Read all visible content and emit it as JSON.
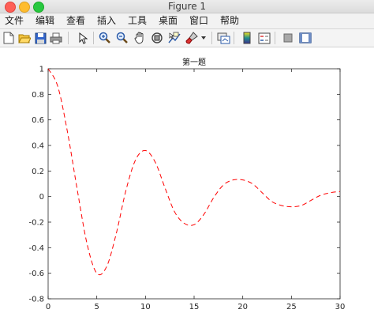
{
  "window": {
    "title": "Figure 1"
  },
  "menu": [
    "文件",
    "编辑",
    "查看",
    "插入",
    "工具",
    "桌面",
    "窗口",
    "帮助"
  ],
  "toolbar": {
    "icons": [
      "new-figure-icon",
      "open-file-icon",
      "save-icon",
      "print-icon",
      "pointer-icon",
      "zoom-in-icon",
      "zoom-out-icon",
      "pan-hand-icon",
      "rotate-3d-icon",
      "data-cursor-icon",
      "brush-icon",
      "colorbar-icon",
      "legend-icon",
      "hide-plot-tools-icon",
      "show-plot-tools-icon"
    ]
  },
  "chart_data": {
    "type": "line",
    "title": "第一题",
    "xlabel": "",
    "ylabel": "",
    "xlim": [
      0,
      30
    ],
    "ylim": [
      -0.8,
      1
    ],
    "xticks": [
      0,
      5,
      10,
      15,
      20,
      25,
      30
    ],
    "yticks": [
      -0.8,
      -0.6,
      -0.4,
      -0.2,
      0,
      0.2,
      0.4,
      0.6,
      0.8,
      1
    ],
    "grid": false,
    "line_color": "#ff0000",
    "line_style": "dashed",
    "x": [
      0,
      1,
      2,
      3,
      4,
      5,
      6,
      7,
      8,
      9,
      10,
      11,
      12,
      13,
      14,
      15,
      16,
      17,
      18,
      19,
      20,
      21,
      22,
      23,
      24,
      25,
      26,
      27,
      28,
      29,
      30
    ],
    "y": [
      1.0,
      0.86,
      0.5,
      0.05,
      -0.37,
      -0.6,
      -0.55,
      -0.29,
      0.05,
      0.29,
      0.36,
      0.27,
      0.07,
      -0.12,
      -0.21,
      -0.22,
      -0.14,
      -0.01,
      0.09,
      0.13,
      0.13,
      0.1,
      0.03,
      -0.04,
      -0.07,
      -0.08,
      -0.07,
      -0.03,
      0.01,
      0.03,
      0.04
    ]
  }
}
